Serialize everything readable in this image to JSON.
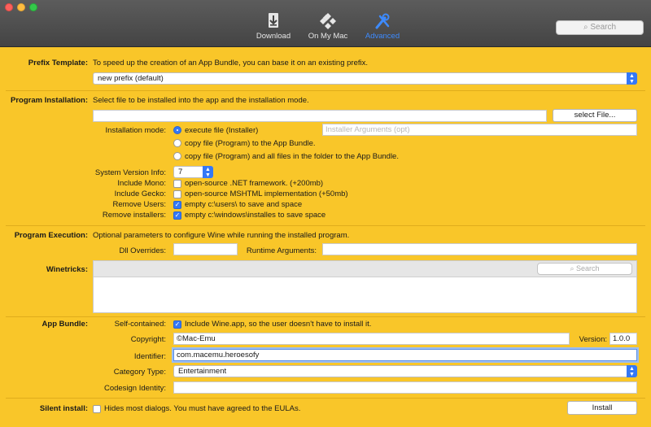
{
  "toolbar": {
    "download": "Download",
    "on_my_mac": "On My Mac",
    "advanced": "Advanced",
    "search_placeholder": "Search"
  },
  "prefix": {
    "label": "Prefix Template:",
    "description": "To speed up the creation of an App Bundle, you can base it on an existing prefix.",
    "selected": "new prefix (default)"
  },
  "install": {
    "label": "Program Installation:",
    "description": "Select file to be installed into the app and the installation mode.",
    "file_value": "",
    "select_button": "select File...",
    "mode_label": "Installation mode:",
    "modes": [
      "execute file (Installer)",
      "copy file (Program)  to the App Bundle.",
      "copy file (Program)  and all files in the folder to the App Bundle."
    ],
    "args_placeholder": "Installer Arguments (opt)",
    "sysver_label": "System Version Info:",
    "sysver_value": "7",
    "mono_label": "Include Mono:",
    "mono_text": "open-source .NET framework. (+200mb)",
    "gecko_label": "Include Gecko:",
    "gecko_text": "open-source MSHTML implementation (+50mb)",
    "remove_users_label": "Remove Users:",
    "remove_users_text": "empty c:\\users\\ to save and space",
    "remove_installers_label": "Remove installers:",
    "remove_installers_text": "empty c:\\windows\\installes to save space"
  },
  "execution": {
    "label": "Program Execution:",
    "description": "Optional parameters to configure Wine while running the installed program.",
    "dll_label": "Dll Overrides:",
    "dll_value": "",
    "runtime_label": "Runtime Arguments:",
    "runtime_value": ""
  },
  "winetricks": {
    "label": "Winetricks:",
    "search_placeholder": "Search"
  },
  "bundle": {
    "label": "App Bundle:",
    "self_contained_label": "Self-contained:",
    "self_contained_text": "Include Wine.app, so the user doesn't have to install it.",
    "copyright_label": "Copyright:",
    "copyright_value": "©Mac-Emu",
    "version_label": "Version:",
    "version_value": "1.0.0",
    "identifier_label": "Identifier:",
    "identifier_value": "com.macemu.heroesofy",
    "category_label": "Category Type:",
    "category_value": "Entertainment",
    "codesign_label": "Codesign Identity:",
    "codesign_value": ""
  },
  "silent": {
    "label": "Silent install:",
    "text": "Hides most dialogs. You must have agreed to the EULAs.",
    "install_button": "Install"
  },
  "colors": {
    "background": "#f9c629",
    "accent": "#3478f6"
  }
}
